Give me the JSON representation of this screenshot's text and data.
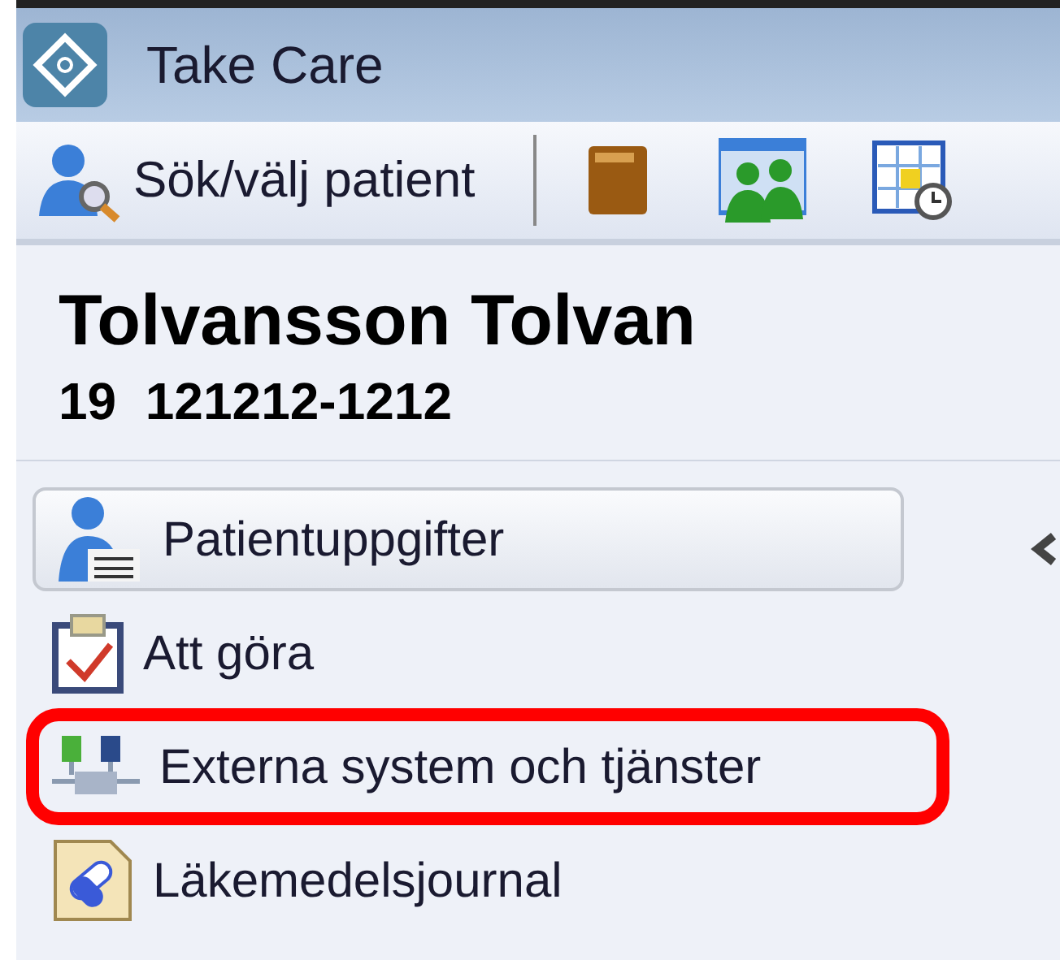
{
  "window": {
    "title": "Take Care"
  },
  "toolbar": {
    "search_button": "Sök/välj patient"
  },
  "patient": {
    "name": "Tolvansson Tolvan",
    "id": "19  121212-1212"
  },
  "nav": [
    {
      "label": "Patientuppgifter",
      "kind": "patient",
      "selected": true,
      "highlighted": false
    },
    {
      "label": "Att göra",
      "kind": "todo",
      "selected": false,
      "highlighted": false
    },
    {
      "label": "Externa system och tjänster",
      "kind": "external",
      "selected": false,
      "highlighted": true
    },
    {
      "label": "Läkemedelsjournal",
      "kind": "medication",
      "selected": false,
      "highlighted": false
    }
  ]
}
